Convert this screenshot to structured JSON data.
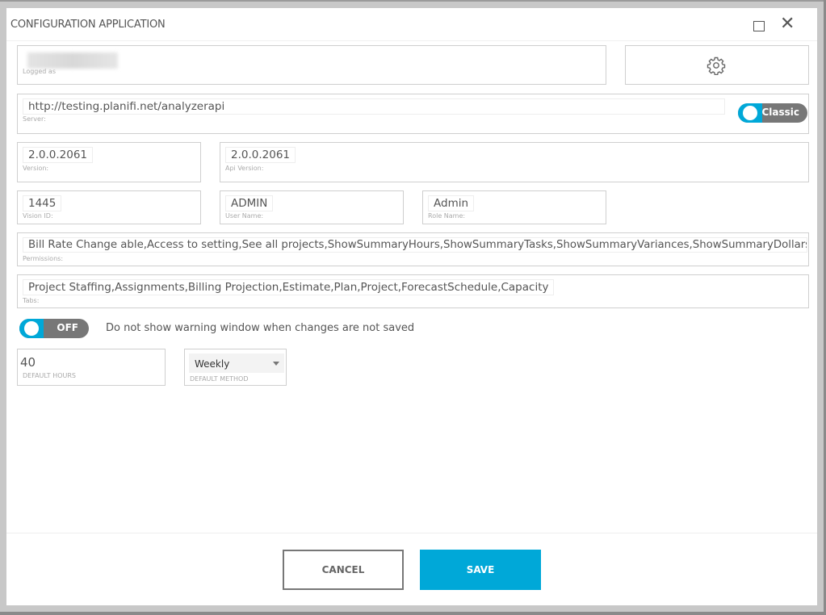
{
  "window": {
    "title": "CONFIGURATION APPLICATION",
    "maximize_icon": "maximize-icon",
    "close_icon": "close-icon"
  },
  "account": {
    "logged_as_value": "(blurred)",
    "logged_as_label": "Logged as",
    "settings_icon": "gear-icon"
  },
  "server": {
    "value": "http://testing.planifi.net/analyzerapi",
    "label": "Server:",
    "mode_toggle": {
      "label": "Classic",
      "state": "on"
    }
  },
  "version": {
    "value": "2.0.0.2061",
    "label": "Version:"
  },
  "api_version": {
    "value": "2.0.0.2061",
    "label": "Api Version:"
  },
  "vision_id": {
    "value": "1445",
    "label": "Vision ID:"
  },
  "user_name": {
    "value": "ADMIN",
    "label": "User Name:"
  },
  "role_name": {
    "value": "Admin",
    "label": "Role Name:"
  },
  "permissions": {
    "value": "Bill Rate Change able,Access to setting,See all projects,ShowSummaryHours,ShowSummaryTasks,ShowSummaryVariances,ShowSummaryDollars,ShowTabPro",
    "label": "Permissions:"
  },
  "tabs": {
    "value": "Project Staffing,Assignments,Billing Projection,Estimate,Plan,Project,ForecastSchedule,Capacity",
    "label": "Tabs:"
  },
  "warning_toggle": {
    "label": "OFF",
    "state": "off",
    "description": "Do not show warning window when changes are not saved"
  },
  "default_hours": {
    "value": "40",
    "label": "DEFAULT HOURS"
  },
  "default_method": {
    "value": "Weekly",
    "label": "DEFAULT METHOD"
  },
  "footer": {
    "cancel_label": "CANCEL",
    "save_label": "SAVE"
  },
  "colors": {
    "accent": "#00a8d8",
    "toggle_track": "#777777"
  }
}
